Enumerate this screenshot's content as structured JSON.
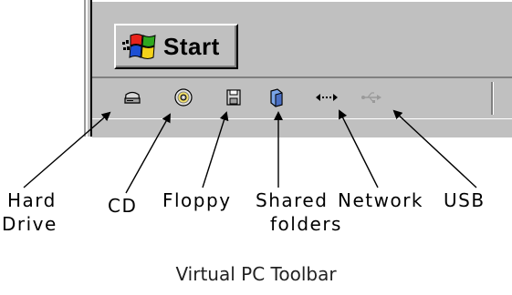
{
  "taskbar": {
    "start_label": "Start"
  },
  "toolbar_icons": [
    {
      "name": "hard-drive-icon"
    },
    {
      "name": "cd-icon"
    },
    {
      "name": "floppy-icon"
    },
    {
      "name": "shared-folders-icon"
    },
    {
      "name": "network-icon"
    },
    {
      "name": "usb-icon"
    }
  ],
  "labels": {
    "hard_drive_1": "Hard",
    "hard_drive_2": "Drive",
    "cd": "CD",
    "floppy": "Floppy",
    "shared_1": "Shared",
    "shared_2": "folders",
    "network": "Network",
    "usb": "USB"
  },
  "caption": "Virtual PC Toolbar",
  "colors": {
    "window_gray": "#c0c0c0",
    "shadow": "#808080",
    "highlight": "#ffffff"
  }
}
